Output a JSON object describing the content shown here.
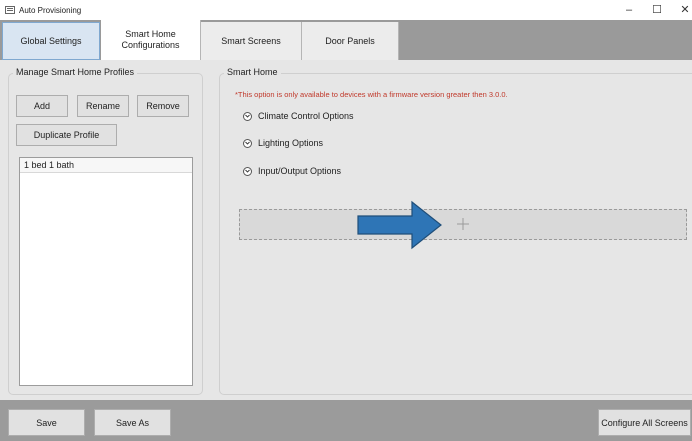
{
  "window": {
    "title": "Auto Provisioning",
    "controls": {
      "minimize": "–",
      "maximize": "☐",
      "close": "✕"
    }
  },
  "tabs": [
    {
      "label": "Global Settings"
    },
    {
      "label": "Smart Home\nConfigurations"
    },
    {
      "label": "Smart Screens"
    },
    {
      "label": "Door Panels"
    }
  ],
  "profiles_group": {
    "title": "Manage Smart Home Profiles",
    "add_label": "Add",
    "rename_label": "Rename",
    "remove_label": "Remove",
    "duplicate_label": "Duplicate Profile",
    "items": [
      {
        "label": "1 bed 1 bath"
      }
    ]
  },
  "smart_home_group": {
    "title": "Smart Home",
    "warning": "*This option is only available to devices with a firmware version greater then 3.0.0.",
    "options": [
      {
        "label": "Climate Control Options"
      },
      {
        "label": "Lighting Options"
      },
      {
        "label": "Input/Output Options"
      }
    ]
  },
  "footer": {
    "save_label": "Save",
    "save_as_label": "Save As",
    "configure_all_label": "Configure All Screens"
  },
  "colors": {
    "warning_text": "#c0392b",
    "tabstrip": "#9a9a9a",
    "arrow_fill": "#2e75b6",
    "arrow_stroke": "#1f4e79"
  }
}
